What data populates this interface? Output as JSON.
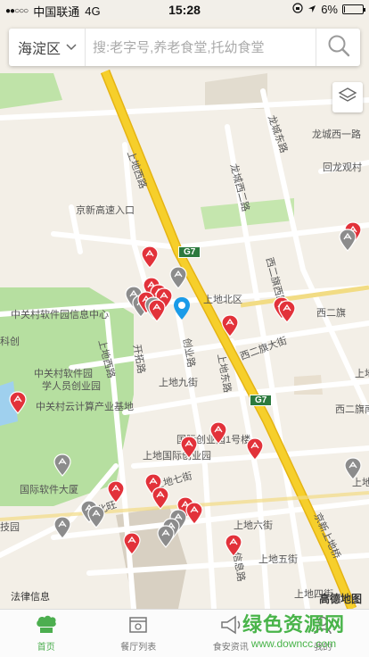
{
  "status_bar": {
    "signal": "●●○○○",
    "carrier": "中国联通",
    "network": "4G",
    "time": "15:28",
    "battery_percent": "6%",
    "battery_level": 0.06
  },
  "search": {
    "district": "海淀区",
    "placeholder": "搜:老字号,养老食堂,托幼食堂"
  },
  "map": {
    "labels": {
      "g7_top": "G7",
      "g7_bottom": "G7",
      "jingxin": "京新高速入口",
      "shangdi_xilu": "上地西路",
      "shangdi_xilu2": "上地西路",
      "shangdi_beiqu": "上地北区",
      "zgc_software": "中关村软件园信息中心",
      "kechuang": "科创",
      "kaituo": "开拓路",
      "chuangye": "创业路",
      "shangdi_east": "上地东路",
      "erqi": "西二旗大街",
      "erqi_right": "西二旗",
      "erqi_mid": "西二旗西路",
      "shangdi9": "上地九街",
      "zgc_software_park": "中关村软件园",
      "xueren": "学人员创业园",
      "zgc_cloud": "中关村云计算产业基地",
      "guoji_chuangye": "国际创业园1号楼",
      "shangdi_guoji": "上地国际创业园",
      "shangdi7": "上地七街",
      "guoji_software": "国际软件大厦",
      "dongbei": "东北旺",
      "jiyuan": "技园",
      "shangdi6": "上地六街",
      "shangdi5": "上地五街",
      "xinxi": "信息路",
      "huilongguan": "回龙观村",
      "longcheng": "龙城西一路",
      "longcheng2": "龙城西二路",
      "longcheng3": "龙城东路",
      "erqi_south": "西二旗南",
      "shang": "上地",
      "shangdi_jia": "上地甲",
      "jingxin_right": "京新上地桥",
      "shangdi4": "上地四街",
      "legal": "法律信息",
      "logo": "高德地图"
    }
  },
  "tabs": [
    {
      "label": "首页",
      "icon": "chef-hat-icon",
      "active": true
    },
    {
      "label": "餐厅列表",
      "icon": "restaurant-list-icon",
      "active": false
    },
    {
      "label": "食安资讯",
      "icon": "megaphone-icon",
      "active": false
    },
    {
      "label": "我的",
      "icon": "user-icon",
      "active": false
    }
  ],
  "watermark": {
    "title": "绿色资源网",
    "url": "www.downcc.com"
  },
  "colors": {
    "accent": "#4cae4f",
    "marker_red": "#e2323a",
    "marker_gray": "#8c8c8c",
    "location_blue": "#1a9be8",
    "highway": "#f6cf2b",
    "park": "#b6dfa0"
  }
}
